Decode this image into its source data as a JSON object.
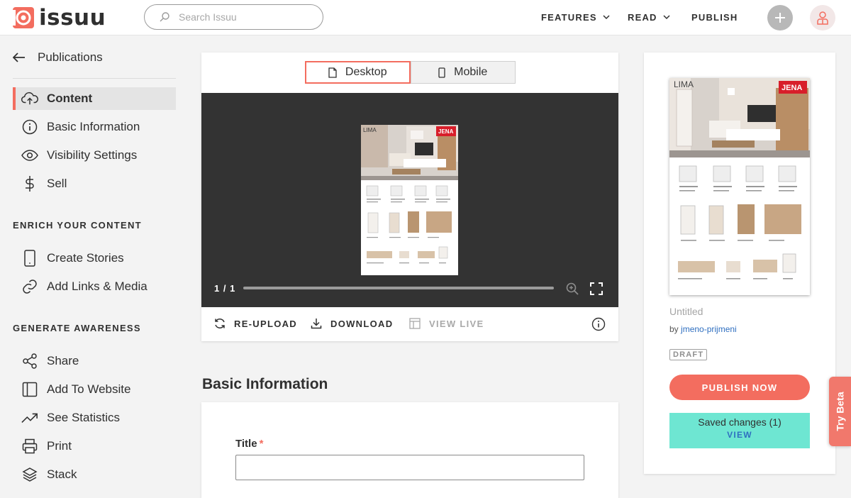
{
  "header": {
    "logo_text": "issuu",
    "search_placeholder": "Search Issuu",
    "nav": [
      {
        "label": "FEATURES",
        "has_dropdown": true
      },
      {
        "label": "READ",
        "has_dropdown": true
      },
      {
        "label": "PUBLISH",
        "has_dropdown": false
      }
    ],
    "icons": {
      "plus": "plus-icon",
      "user": "user-icon"
    }
  },
  "sidebar": {
    "back_label": "Publications",
    "items": [
      {
        "label": "Content",
        "icon": "upload-cloud-icon",
        "active": true
      },
      {
        "label": "Basic Information",
        "icon": "info-icon"
      },
      {
        "label": "Visibility Settings",
        "icon": "eye-icon"
      },
      {
        "label": "Sell",
        "icon": "dollar-icon"
      }
    ],
    "enrich_heading": "ENRICH YOUR CONTENT",
    "enrich_items": [
      {
        "label": "Create Stories",
        "icon": "phone-icon"
      },
      {
        "label": "Add Links & Media",
        "icon": "link-icon"
      }
    ],
    "awareness_heading": "GENERATE AWARENESS",
    "awareness_items": [
      {
        "label": "Share",
        "icon": "share-icon"
      },
      {
        "label": "Add To Website",
        "icon": "embed-icon"
      },
      {
        "label": "See Statistics",
        "icon": "trend-icon"
      },
      {
        "label": "Print",
        "icon": "printer-icon"
      },
      {
        "label": "Stack",
        "icon": "layers-icon"
      }
    ]
  },
  "preview": {
    "toggle": [
      {
        "label": "Desktop",
        "icon": "document-icon",
        "active": true
      },
      {
        "label": "Mobile",
        "icon": "mobile-icon",
        "active": false
      }
    ],
    "page_counter": "1 / 1",
    "doc": {
      "title": "LIMA",
      "brand": "JENA"
    },
    "actions": [
      {
        "label": "RE-UPLOAD",
        "icon": "refresh-icon",
        "enabled": true
      },
      {
        "label": "DOWNLOAD",
        "icon": "download-icon",
        "enabled": true
      },
      {
        "label": "VIEW LIVE",
        "icon": "view-live-icon",
        "enabled": false
      }
    ]
  },
  "basic_info": {
    "section_title": "Basic Information",
    "title_label": "Title",
    "required_marker": "*",
    "title_value": ""
  },
  "publication": {
    "title": "Untitled",
    "by_prefix": "by",
    "author": "jmeno-prijmeni",
    "status": "DRAFT",
    "publish_label": "PUBLISH NOW",
    "saved_text": "Saved changes (1)",
    "saved_view": "VIEW"
  },
  "beta_label": "Try Beta",
  "colors": {
    "accent": "#f36d5f",
    "saved_bg": "#6ee6d2",
    "link": "#2f6fc0",
    "viewer_bg": "#333333"
  }
}
